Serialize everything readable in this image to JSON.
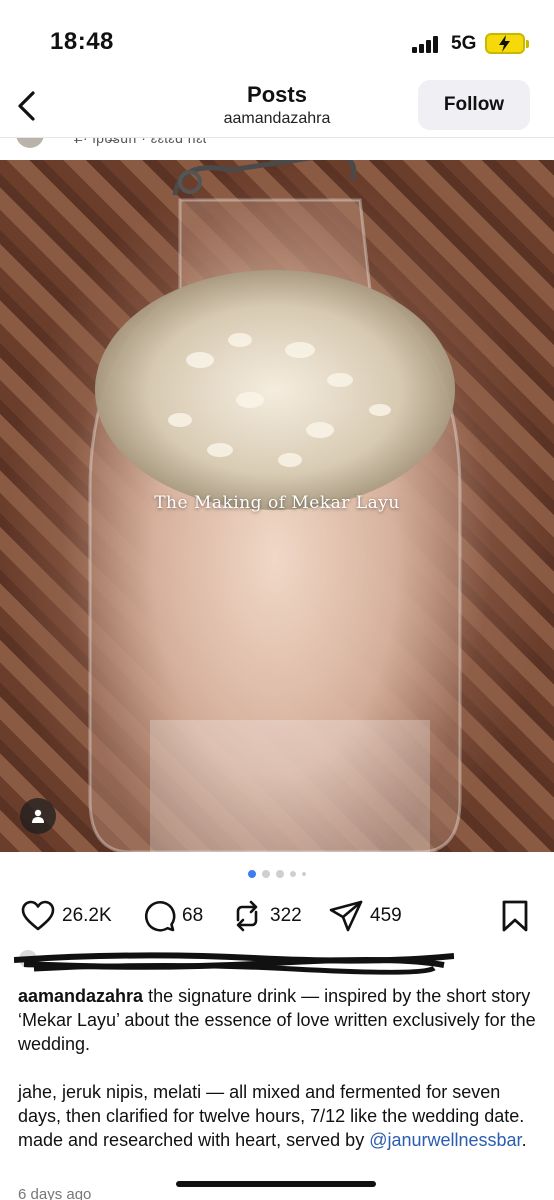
{
  "status": {
    "time": "18:48",
    "network": "5G"
  },
  "header": {
    "title": "Posts",
    "username": "aamandazahra",
    "follow_label": "Follow"
  },
  "cut_strip": {
    "partial_text": "Ɩ̶ · Ɩpo̶sun · ɛɛɩɛɑ ɦɛɩ"
  },
  "photo": {
    "overlay_text": "The Making of Mekar Layu"
  },
  "carousel": {
    "count": 5,
    "active_index": 0
  },
  "actions": {
    "likes": "26.2K",
    "comments": "68",
    "reposts": "322",
    "shares": "459"
  },
  "caption": {
    "username": "aamandazahra",
    "paragraph1": " the signature drink — inspired by the short story ‘Mekar Layu’ about the essence of love written exclusively for the wedding.",
    "paragraph2_text": "jahe, jeruk nipis, melati — all mixed and fermented for seven days, then clarified for twelve hours, 7/12 like the wedding date. made and researched with heart, served by ",
    "mention": "@janurwellnessbar",
    "paragraph2_end": "."
  },
  "time_ago": "6 days ago",
  "icons": [
    "back-icon",
    "heart-icon",
    "comment-icon",
    "repost-icon",
    "share-icon",
    "bookmark-icon",
    "person-tag-icon",
    "signal-icon",
    "battery-icon"
  ]
}
